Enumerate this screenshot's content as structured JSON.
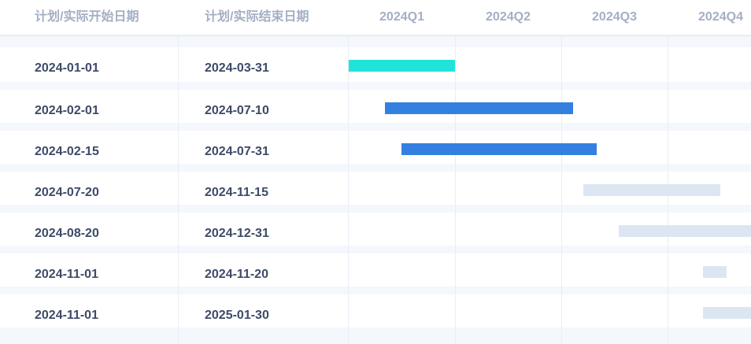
{
  "header": {
    "start_label": "计划/实际开始日期",
    "end_label": "计划/实际结束日期",
    "quarters": [
      "2024Q1",
      "2024Q2",
      "2024Q3",
      "2024Q4"
    ]
  },
  "colors": {
    "actual_done": "#22e3d9",
    "actual_in_progress": "#3480e0",
    "planned": "#dce6f3"
  },
  "tasks": [
    {
      "start": "2024-01-01",
      "end": "2024-03-31",
      "status": "actual_done"
    },
    {
      "start": "2024-02-01",
      "end": "2024-07-10",
      "status": "actual_in_progress"
    },
    {
      "start": "2024-02-15",
      "end": "2024-07-31",
      "status": "actual_in_progress"
    },
    {
      "start": "2024-07-20",
      "end": "2024-11-15",
      "status": "planned"
    },
    {
      "start": "2024-08-20",
      "end": "2024-12-31",
      "status": "planned"
    },
    {
      "start": "2024-11-01",
      "end": "2024-11-20",
      "status": "planned"
    },
    {
      "start": "2024-11-01",
      "end": "2025-01-30",
      "status": "planned"
    }
  ]
}
